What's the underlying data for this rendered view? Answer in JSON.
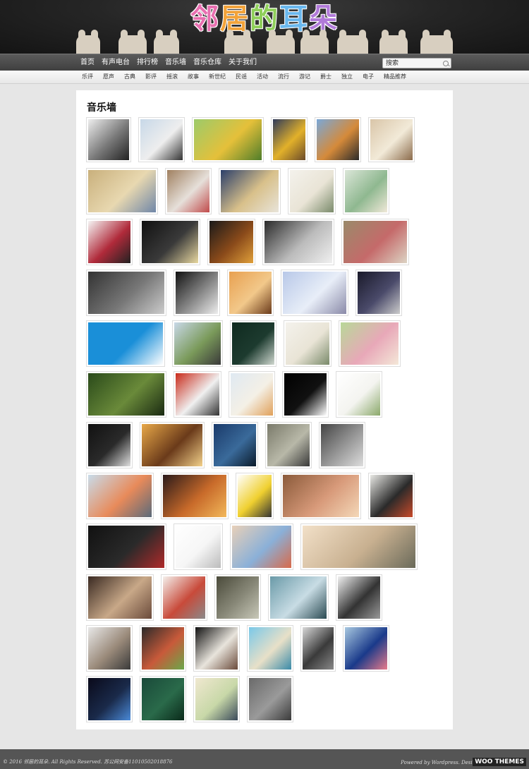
{
  "site": {
    "logo_chars": [
      "邻",
      "居",
      "的",
      "耳",
      "朵"
    ],
    "logo_colors": [
      "#e86fb0",
      "#f2a33a",
      "#8fcf5a",
      "#6ab8ee",
      "#b17ad8"
    ]
  },
  "nav": {
    "items": [
      "首页",
      "有声电台",
      "排行榜",
      "音乐墙",
      "音乐仓库",
      "关于我们"
    ],
    "search_placeholder": "搜索"
  },
  "tags": [
    "乐评",
    "愿声",
    "古典",
    "影评",
    "摇滚",
    "故事",
    "新世纪",
    "民谣",
    "活动",
    "流行",
    "游记",
    "爵士",
    "独立",
    "电子",
    "精品推荐"
  ],
  "page": {
    "title": "音乐墙"
  },
  "photo_rows": [
    {
      "photos": [
        {
          "w": 64,
          "h": 64,
          "colors": [
            "#eeeeee",
            "#777777",
            "#222222"
          ]
        },
        {
          "w": 66,
          "h": 64,
          "colors": [
            "#c7d8e8",
            "#eeeeee",
            "#333333"
          ]
        },
        {
          "w": 102,
          "h": 64,
          "colors": [
            "#9ccb6a",
            "#e5c03a",
            "#4f7d2a"
          ]
        },
        {
          "w": 52,
          "h": 64,
          "colors": [
            "#2f3a5a",
            "#e2b12a",
            "#6b4b2a"
          ]
        },
        {
          "w": 66,
          "h": 64,
          "colors": [
            "#7aa8d8",
            "#d58a3a",
            "#2b2b2b"
          ]
        },
        {
          "w": 66,
          "h": 64,
          "colors": [
            "#d9c5a8",
            "#f2ead8",
            "#8a6a4a"
          ]
        }
      ]
    },
    {
      "photos": [
        {
          "w": 102,
          "h": 66,
          "colors": [
            "#c9b07c",
            "#e8d8b0",
            "#6f86a8"
          ]
        },
        {
          "w": 66,
          "h": 66,
          "colors": [
            "#a08060",
            "#e6e0da",
            "#c04a4a"
          ]
        },
        {
          "w": 88,
          "h": 66,
          "colors": [
            "#2b3f6a",
            "#d8c08a",
            "#e8e4da"
          ]
        },
        {
          "w": 68,
          "h": 66,
          "colors": [
            "#f4f2ec",
            "#e9e4d6",
            "#7a8a6a"
          ]
        },
        {
          "w": 66,
          "h": 66,
          "colors": [
            "#dbe6d8",
            "#8fb890",
            "#f0e8d8"
          ]
        }
      ]
    },
    {
      "photos": [
        {
          "w": 66,
          "h": 66,
          "colors": [
            "#f5f5f5",
            "#b02a3a",
            "#222222"
          ]
        },
        {
          "w": 86,
          "h": 66,
          "colors": [
            "#111111",
            "#3a3a3a",
            "#e8d8a0"
          ]
        },
        {
          "w": 68,
          "h": 66,
          "colors": [
            "#1a1a1a",
            "#8a4a1a",
            "#e0a03a"
          ]
        },
        {
          "w": 102,
          "h": 66,
          "colors": [
            "#2a2a2a",
            "#bbbbbb",
            "#f0f0f0"
          ]
        },
        {
          "w": 96,
          "h": 66,
          "colors": [
            "#9a8a6a",
            "#c56a6a",
            "#dcd4c4"
          ]
        }
      ]
    },
    {
      "photos": [
        {
          "w": 114,
          "h": 66,
          "colors": [
            "#333333",
            "#777777",
            "#cccccc"
          ]
        },
        {
          "w": 66,
          "h": 66,
          "colors": [
            "#111111",
            "#888888",
            "#eeeeee"
          ]
        },
        {
          "w": 66,
          "h": 66,
          "colors": [
            "#e8a050",
            "#f2c88a",
            "#6a3a1a"
          ]
        },
        {
          "w": 96,
          "h": 66,
          "colors": [
            "#b8c8e8",
            "#e8eef8",
            "#8a8aa8"
          ]
        },
        {
          "w": 66,
          "h": 66,
          "colors": [
            "#1a1a2a",
            "#4a4a6a",
            "#cccccc"
          ]
        }
      ]
    },
    {
      "photos": [
        {
          "w": 112,
          "h": 66,
          "colors": [
            "#1a8fd8",
            "#1a8fd8",
            "#ffffff"
          ]
        },
        {
          "w": 72,
          "h": 66,
          "colors": [
            "#c8d8e8",
            "#7a9a5a",
            "#3a3a3a"
          ]
        },
        {
          "w": 66,
          "h": 66,
          "colors": [
            "#0f2a1f",
            "#1d3b2f",
            "#d0d8d0"
          ]
        },
        {
          "w": 68,
          "h": 66,
          "colors": [
            "#f4f2ec",
            "#e9e4d6",
            "#7a8a6a"
          ]
        },
        {
          "w": 88,
          "h": 66,
          "colors": [
            "#b8d898",
            "#e8a8b8",
            "#f4e8d8"
          ]
        }
      ]
    },
    {
      "photos": [
        {
          "w": 114,
          "h": 66,
          "colors": [
            "#2a4a1a",
            "#6a8a3a",
            "#1a2a12"
          ]
        },
        {
          "w": 68,
          "h": 66,
          "colors": [
            "#c82a1a",
            "#f0f0f0",
            "#333333"
          ]
        },
        {
          "w": 66,
          "h": 66,
          "colors": [
            "#dfe9f2",
            "#f4f0e6",
            "#e0a05a"
          ]
        },
        {
          "w": 66,
          "h": 66,
          "colors": [
            "#000000",
            "#111111",
            "#ffffff"
          ]
        },
        {
          "w": 66,
          "h": 66,
          "colors": [
            "#ffffff",
            "#f4f4f0",
            "#8aa86a"
          ]
        }
      ]
    },
    {
      "photos": [
        {
          "w": 66,
          "h": 66,
          "colors": [
            "#111111",
            "#2a2a2a",
            "#e0e0e0"
          ]
        },
        {
          "w": 92,
          "h": 66,
          "colors": [
            "#e8a848",
            "#6a3a1a",
            "#f2d08a"
          ]
        },
        {
          "w": 66,
          "h": 66,
          "colors": [
            "#1a3a6a",
            "#3a6a9a",
            "#0a1a2a"
          ]
        },
        {
          "w": 66,
          "h": 66,
          "colors": [
            "#7a7a6a",
            "#b8b8a8",
            "#3a3a3a"
          ]
        },
        {
          "w": 66,
          "h": 66,
          "colors": [
            "#444444",
            "#999999",
            "#dddddd"
          ]
        }
      ]
    },
    {
      "photos": [
        {
          "w": 96,
          "h": 66,
          "colors": [
            "#c8dcea",
            "#e88a5a",
            "#5a6a7a"
          ]
        },
        {
          "w": 96,
          "h": 66,
          "colors": [
            "#2a1a1a",
            "#c86a2a",
            "#f2b85a"
          ]
        },
        {
          "w": 54,
          "h": 66,
          "colors": [
            "#ffffff",
            "#f0d030",
            "#333333"
          ]
        },
        {
          "w": 114,
          "h": 66,
          "colors": [
            "#8a5a3a",
            "#d89a7a",
            "#f4d8b8"
          ]
        },
        {
          "w": 66,
          "h": 66,
          "colors": [
            "#e8e8e4",
            "#2a2a2a",
            "#c84a2a"
          ]
        }
      ]
    },
    {
      "photos": [
        {
          "w": 114,
          "h": 66,
          "colors": [
            "#111111",
            "#2a2a2a",
            "#b02a2a"
          ]
        },
        {
          "w": 70,
          "h": 66,
          "colors": [
            "#ffffff",
            "#f6f6f6",
            "#bbbbbb"
          ]
        },
        {
          "w": 90,
          "h": 66,
          "colors": [
            "#e8d0b8",
            "#8ab0d8",
            "#d86a4a"
          ]
        },
        {
          "w": 166,
          "h": 66,
          "colors": [
            "#f2e0c8",
            "#c8b090",
            "#6a6a5a"
          ]
        }
      ]
    },
    {
      "photos": [
        {
          "w": 96,
          "h": 66,
          "colors": [
            "#3a2a22",
            "#c8a888",
            "#6a4a3a"
          ]
        },
        {
          "w": 66,
          "h": 66,
          "colors": [
            "#f4f0ec",
            "#c84a3a",
            "#8a8a8a"
          ]
        },
        {
          "w": 66,
          "h": 66,
          "colors": [
            "#4a4a3a",
            "#8a8a7a",
            "#c8c8b8"
          ]
        },
        {
          "w": 86,
          "h": 66,
          "colors": [
            "#6a9aa8",
            "#c8dce4",
            "#2a4a52"
          ]
        },
        {
          "w": 66,
          "h": 66,
          "colors": [
            "#f0f0f0",
            "#333333",
            "#999999"
          ]
        }
      ]
    },
    {
      "photos": [
        {
          "w": 66,
          "h": 66,
          "colors": [
            "#e8e8e8",
            "#9a8a7a",
            "#3a3a3a"
          ]
        },
        {
          "w": 66,
          "h": 66,
          "colors": [
            "#2a2a2a",
            "#c85a3a",
            "#6aa84a"
          ]
        },
        {
          "w": 66,
          "h": 66,
          "colors": [
            "#111111",
            "#e8e4dc",
            "#6a4a3a"
          ]
        },
        {
          "w": 66,
          "h": 66,
          "colors": [
            "#7ac8e8",
            "#e8e0c8",
            "#3a8aa8"
          ]
        },
        {
          "w": 50,
          "h": 66,
          "colors": [
            "#d8d8d8",
            "#3a3a3a",
            "#888888"
          ]
        },
        {
          "w": 66,
          "h": 66,
          "colors": [
            "#a8c8e0",
            "#1a3a8a",
            "#e87a8a"
          ]
        }
      ]
    },
    {
      "photos": [
        {
          "w": 66,
          "h": 66,
          "colors": [
            "#0a0a1a",
            "#1a2a4a",
            "#4a8ad8"
          ]
        },
        {
          "w": 66,
          "h": 66,
          "colors": [
            "#1a4a3a",
            "#2a6a4a",
            "#0a2a1a"
          ]
        },
        {
          "w": 66,
          "h": 66,
          "colors": [
            "#f0e8d0",
            "#c8d8a8",
            "#3a4a5a"
          ]
        },
        {
          "w": 66,
          "h": 66,
          "colors": [
            "#6a6a6a",
            "#9a9a9a",
            "#3a3a3a"
          ]
        }
      ]
    }
  ],
  "footer": {
    "copyright": "© 2016 邻居的耳朵. All Rights Reserved. 苏公网安备11010502018876",
    "powered": "Powered by Wordpress. Designed by",
    "brand": "WOO THEMES"
  }
}
